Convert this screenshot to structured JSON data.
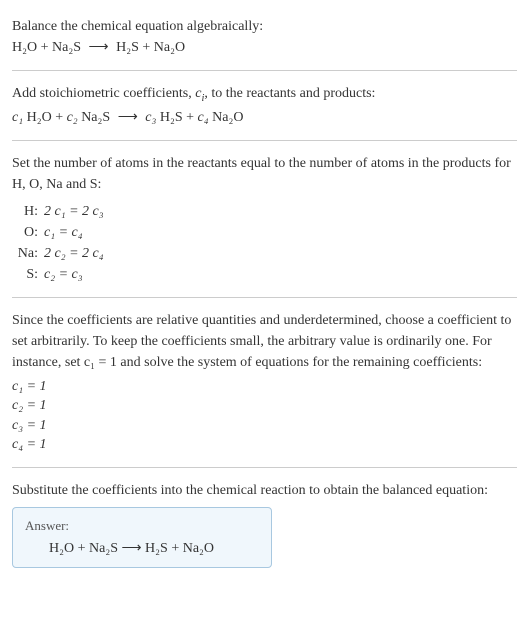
{
  "section1": {
    "title": "Balance the chemical equation algebraically:",
    "eq_left": "H₂O + Na₂S",
    "eq_arrow": "⟶",
    "eq_right": "H₂S + Na₂O"
  },
  "section2": {
    "title_a": "Add stoichiometric coefficients, ",
    "title_var": "c",
    "title_sub": "i",
    "title_b": ", to the reactants and products:",
    "c1": "c₁",
    "t1": " H₂O + ",
    "c2": "c₂",
    "t2": " Na₂S ",
    "arrow": "⟶",
    "c3": " c₃",
    "t3": " H₂S + ",
    "c4": "c₄",
    "t4": " Na₂O"
  },
  "section3": {
    "title": "Set the number of atoms in the reactants equal to the number of atoms in the products for H, O, Na and S:",
    "rows": [
      {
        "label": "H:",
        "eq": "2 c₁ = 2 c₃"
      },
      {
        "label": "O:",
        "eq": "c₁ = c₄"
      },
      {
        "label": "Na:",
        "eq": "2 c₂ = 2 c₄"
      },
      {
        "label": "S:",
        "eq": "c₂ = c₃"
      }
    ]
  },
  "section4": {
    "text": "Since the coefficients are relative quantities and underdetermined, choose a coefficient to set arbitrarily. To keep the coefficients small, the arbitrary value is ordinarily one. For instance, set c₁ = 1 and solve the system of equations for the remaining coefficients:",
    "coefs": [
      "c₁ = 1",
      "c₂ = 1",
      "c₃ = 1",
      "c₄ = 1"
    ]
  },
  "section5": {
    "text": "Substitute the coefficients into the chemical reaction to obtain the balanced equation:",
    "answer_label": "Answer:",
    "answer_eq": "H₂O + Na₂S  ⟶  H₂S + Na₂O"
  }
}
